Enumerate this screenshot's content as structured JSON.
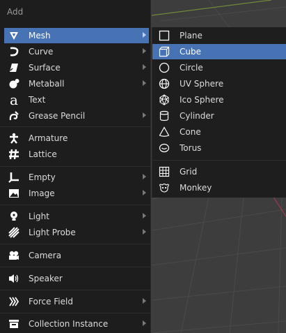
{
  "menu": {
    "title": "Add",
    "items": [
      {
        "label": "Mesh",
        "icon": "mesh-icon",
        "submenu": true,
        "active": true
      },
      {
        "label": "Curve",
        "icon": "curve-icon",
        "submenu": true
      },
      {
        "label": "Surface",
        "icon": "surface-icon",
        "submenu": true
      },
      {
        "label": "Metaball",
        "icon": "metaball-icon",
        "submenu": true
      },
      {
        "label": "Text",
        "icon": "text-icon",
        "submenu": false
      },
      {
        "label": "Grease Pencil",
        "icon": "grease-pencil-icon",
        "submenu": true
      },
      {
        "label": "Armature",
        "icon": "armature-icon",
        "submenu": false
      },
      {
        "label": "Lattice",
        "icon": "lattice-icon",
        "submenu": false
      },
      {
        "label": "Empty",
        "icon": "empty-icon",
        "submenu": true
      },
      {
        "label": "Image",
        "icon": "image-icon",
        "submenu": true
      },
      {
        "label": "Light",
        "icon": "light-icon",
        "submenu": true
      },
      {
        "label": "Light Probe",
        "icon": "light-probe-icon",
        "submenu": true
      },
      {
        "label": "Camera",
        "icon": "camera-icon",
        "submenu": false
      },
      {
        "label": "Speaker",
        "icon": "speaker-icon",
        "submenu": false
      },
      {
        "label": "Force Field",
        "icon": "force-field-icon",
        "submenu": true
      },
      {
        "label": "Collection Instance",
        "icon": "collection-instance-icon",
        "submenu": true
      }
    ]
  },
  "submenu": {
    "items": [
      {
        "label": "Plane",
        "icon": "plane-icon"
      },
      {
        "label": "Cube",
        "icon": "cube-icon",
        "active": true
      },
      {
        "label": "Circle",
        "icon": "circle-icon"
      },
      {
        "label": "UV Sphere",
        "icon": "uv-sphere-icon"
      },
      {
        "label": "Ico Sphere",
        "icon": "ico-sphere-icon"
      },
      {
        "label": "Cylinder",
        "icon": "cylinder-icon"
      },
      {
        "label": "Cone",
        "icon": "cone-icon"
      },
      {
        "label": "Torus",
        "icon": "torus-icon"
      },
      {
        "label": "Grid",
        "icon": "grid-icon"
      },
      {
        "label": "Monkey",
        "icon": "monkey-icon"
      }
    ]
  },
  "colors": {
    "highlight": "#4772b3",
    "menu_bg": "#1d1d1d",
    "viewport_bg": "#3d3d3d"
  }
}
